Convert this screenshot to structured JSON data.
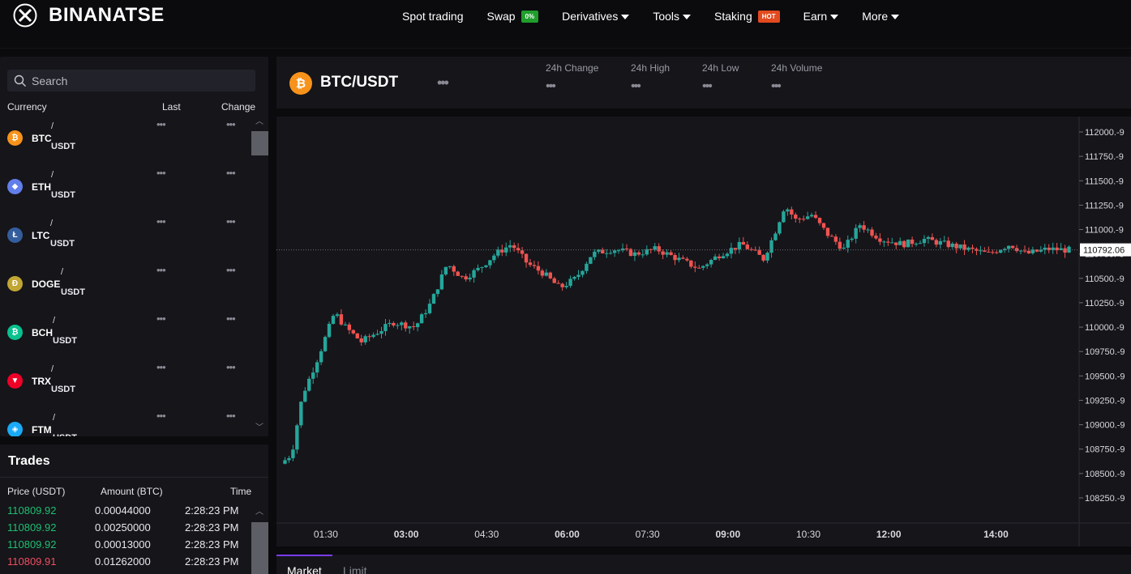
{
  "brand": {
    "name": "BINANATSE",
    "logo_icon": "logo-x-icon"
  },
  "nav": {
    "items": [
      {
        "label": "Spot trading",
        "badge": "",
        "dropdown": false
      },
      {
        "label": "Swap",
        "badge": "0%",
        "badge_color": "#1f9e2c",
        "dropdown": false
      },
      {
        "label": "Derivatives",
        "badge": "",
        "dropdown": true
      },
      {
        "label": "Tools",
        "badge": "",
        "dropdown": true
      },
      {
        "label": "Staking",
        "badge": "HOT",
        "badge_color": "#e34a1f",
        "dropdown": false
      },
      {
        "label": "Earn",
        "badge": "",
        "dropdown": true
      },
      {
        "label": "More",
        "badge": "",
        "dropdown": true
      }
    ]
  },
  "market": {
    "search_placeholder": "Search",
    "columns": {
      "currency": "Currency",
      "last": "Last",
      "change": "Change"
    },
    "coins": [
      {
        "symbol": "BTC",
        "quote": "USDT",
        "last": "•••",
        "change": "•••",
        "color": "#f7931a",
        "glyph": "₿"
      },
      {
        "symbol": "ETH",
        "quote": "USDT",
        "last": "•••",
        "change": "•••",
        "color": "#627eea",
        "glyph": "◆"
      },
      {
        "symbol": "LTC",
        "quote": "USDT",
        "last": "•••",
        "change": "•••",
        "color": "#345d9d",
        "glyph": "Ł"
      },
      {
        "symbol": "DOGE",
        "quote": "USDT",
        "last": "•••",
        "change": "•••",
        "color": "#c2a633",
        "glyph": "Ð"
      },
      {
        "symbol": "BCH",
        "quote": "USDT",
        "last": "•••",
        "change": "•••",
        "color": "#0ac18e",
        "glyph": "₿"
      },
      {
        "symbol": "TRX",
        "quote": "USDT",
        "last": "•••",
        "change": "•••",
        "color": "#ef0027",
        "glyph": "▼"
      },
      {
        "symbol": "FTM",
        "quote": "USDT",
        "last": "•••",
        "change": "•••",
        "color": "#1aaaf7",
        "glyph": "◈"
      }
    ]
  },
  "trades": {
    "title": "Trades",
    "columns": {
      "price": "Price (USDT)",
      "amount": "Amount (BTC)",
      "time": "Time"
    },
    "rows": [
      {
        "price": "110809.92",
        "amount": "0.00044000",
        "time": "2:28:23 PM",
        "side": "up"
      },
      {
        "price": "110809.92",
        "amount": "0.00250000",
        "time": "2:28:23 PM",
        "side": "up"
      },
      {
        "price": "110809.92",
        "amount": "0.00013000",
        "time": "2:28:23 PM",
        "side": "up"
      },
      {
        "price": "110809.91",
        "amount": "0.01262000",
        "time": "2:28:23 PM",
        "side": "down"
      }
    ]
  },
  "pair": {
    "name": "BTC/USDT",
    "more": "•••",
    "stats": [
      {
        "label": "24h Change",
        "value": "•••"
      },
      {
        "label": "24h High",
        "value": "•••"
      },
      {
        "label": "24h Low",
        "value": "•••"
      },
      {
        "label": "24h Volume",
        "value": "•••"
      }
    ]
  },
  "order_tabs": {
    "market": "Market",
    "limit": "Limit"
  },
  "colors": {
    "up": "#26a69a",
    "down": "#ef5350",
    "accent": "#7a3cf0",
    "bg": "#0b0b0e",
    "panel": "#15151a"
  },
  "chart_data": {
    "type": "candlestick",
    "y_ticks": [
      "112000.-9",
      "111750.-9",
      "111500.-9",
      "111250.-9",
      "111000.-9",
      "110750.-9",
      "110500.-9",
      "110250.-9",
      "110000.-9",
      "109750.-9",
      "109500.-9",
      "109250.-9",
      "109000.-9",
      "108750.-9",
      "108500.-9",
      "108250.-9"
    ],
    "ylim": [
      108150,
      112100
    ],
    "last_price_label": "110792.06",
    "last_price": 110792,
    "x_ticks": [
      {
        "label": "01:30",
        "bold": false,
        "t": 1.5
      },
      {
        "label": "03:00",
        "bold": true,
        "t": 3.0
      },
      {
        "label": "04:30",
        "bold": false,
        "t": 4.5
      },
      {
        "label": "06:00",
        "bold": true,
        "t": 6.0
      },
      {
        "label": "07:30",
        "bold": false,
        "t": 7.5
      },
      {
        "label": "09:00",
        "bold": true,
        "t": 9.0
      },
      {
        "label": "10:30",
        "bold": false,
        "t": 10.5
      },
      {
        "label": "12:00",
        "bold": true,
        "t": 12.0
      },
      {
        "label": "14:00",
        "bold": true,
        "t": 14.0
      }
    ],
    "xlim": [
      0.7,
      15.4
    ],
    "series_waypoints": [
      [
        0.7,
        108600
      ],
      [
        0.9,
        108700
      ],
      [
        1.1,
        109300
      ],
      [
        1.4,
        109700
      ],
      [
        1.7,
        110150
      ],
      [
        1.9,
        110000
      ],
      [
        2.2,
        109850
      ],
      [
        2.5,
        109950
      ],
      [
        2.8,
        110050
      ],
      [
        3.2,
        110000
      ],
      [
        3.5,
        110250
      ],
      [
        3.8,
        110650
      ],
      [
        4.1,
        110500
      ],
      [
        4.4,
        110600
      ],
      [
        4.7,
        110750
      ],
      [
        5.0,
        110850
      ],
      [
        5.3,
        110650
      ],
      [
        5.6,
        110550
      ],
      [
        5.9,
        110400
      ],
      [
        6.2,
        110500
      ],
      [
        6.5,
        110750
      ],
      [
        6.9,
        110800
      ],
      [
        7.3,
        110750
      ],
      [
        7.7,
        110800
      ],
      [
        8.1,
        110700
      ],
      [
        8.5,
        110600
      ],
      [
        8.9,
        110750
      ],
      [
        9.3,
        110850
      ],
      [
        9.7,
        110700
      ],
      [
        9.9,
        110950
      ],
      [
        10.1,
        111250
      ],
      [
        10.3,
        111100
      ],
      [
        10.6,
        111150
      ],
      [
        10.9,
        110950
      ],
      [
        11.2,
        110800
      ],
      [
        11.5,
        111050
      ],
      [
        11.9,
        110900
      ],
      [
        12.3,
        110850
      ],
      [
        12.7,
        110900
      ],
      [
        13.1,
        110850
      ],
      [
        13.5,
        110800
      ],
      [
        13.9,
        110750
      ],
      [
        14.3,
        110850
      ],
      [
        14.6,
        110750
      ],
      [
        15.0,
        110800
      ],
      [
        15.4,
        110790
      ]
    ]
  }
}
